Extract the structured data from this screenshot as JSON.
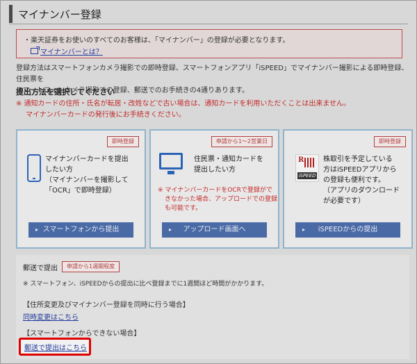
{
  "page": {
    "title": "マイナンバー登録"
  },
  "notice": {
    "text": "・楽天証券をお使いのすべてのお客様は、「マイナンバー」の登録が必要となります。",
    "link": "マイナンバーとは？"
  },
  "description": {
    "line1": "登録方法はスマートフォンカメラ撮影での即時登録、スマートフォンアプリ「iSPEED」でマイナンバー撮影による即時登録、住民票を",
    "line2": "スマートフォンカメラ撮影での登録、郵送でのお手続きの4通りあります。"
  },
  "choose_label": "提出方法を選択してください",
  "warning": {
    "line1": "※ 通知カードの住所・氏名が転居・改姓などで古い場合は、通知カードを利用いただくことは出来ません。",
    "line2": "マイナンバーカードの発行後にお手続きください。"
  },
  "cards": [
    {
      "badge": "即時登録",
      "icon": "smartphone-icon",
      "lines": [
        "マイナンバーカードを提出",
        "したい方",
        "（マイナンバーを撮影して",
        "「OCR」で即時登録）"
      ],
      "button": "スマートフォンから提出"
    },
    {
      "badge": "申請から1～2営業日",
      "icon": "monitor-icon",
      "lines": [
        "住民票・通知カードを",
        "提出したい方"
      ],
      "note": [
        "※ マイナンバーカードをOCRで登録がで",
        "きなかった場合、アップロードでの登録",
        "も可能です。"
      ],
      "button": "アップロード画面へ"
    },
    {
      "badge": "即時登録",
      "icon": "ispeed-icon",
      "icon_label": "iSPEED",
      "lines": [
        "株取引を予定している",
        "方はiSPEEDアプリから",
        "の登録も便利です。",
        "（アプリのダウンロード",
        "が必要です）"
      ],
      "button": "iSPEEDからの提出"
    }
  ],
  "mail": {
    "title": "郵送で提出",
    "badge": "申請から1週間程度",
    "note": "※ スマートフォン、iSPEEDからの提出に比べ登録までに1週間ほど時間がかかります。",
    "section1_heading": "【住所変更及びマイナンバー登録を同時に行う場合】",
    "section1_link": "同時変更はこちら",
    "section2_heading": "【スマートフォンからできない場合】",
    "section2_link": "郵送で提出はこちら"
  },
  "colors": {
    "accent": "#4a6aa6",
    "warning": "#c42a2a",
    "highlight": "#e00000"
  }
}
